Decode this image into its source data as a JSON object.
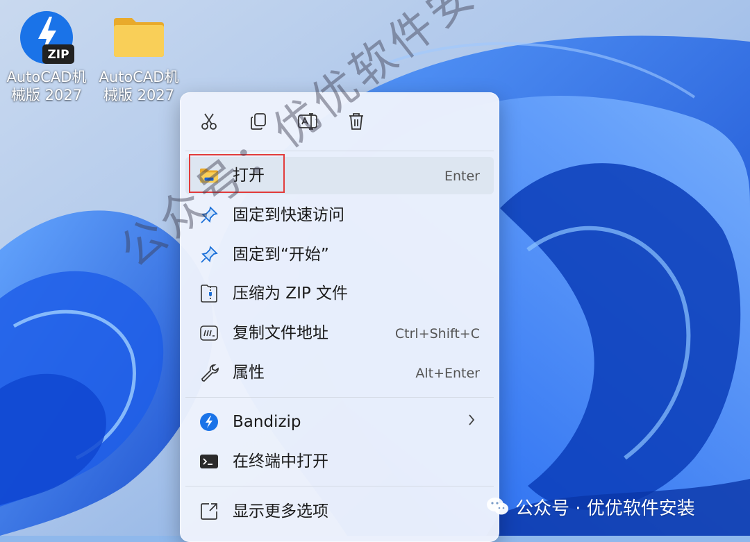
{
  "desktop": {
    "icons": [
      {
        "label": "AutoCAD机\n械版 2027",
        "icon": "bandizip-zip-icon",
        "badge": "ZIP"
      },
      {
        "label": "AutoCAD机\n械版 2027",
        "icon": "folder-icon"
      }
    ]
  },
  "context_menu": {
    "toolbar": [
      {
        "icon": "cut-icon"
      },
      {
        "icon": "copy-icon"
      },
      {
        "icon": "rename-icon"
      },
      {
        "icon": "delete-icon"
      }
    ],
    "items": [
      {
        "label": "打开",
        "shortcut": "Enter",
        "icon": "folder-open-icon"
      },
      {
        "label": "固定到快速访问",
        "shortcut": "",
        "icon": "pin-icon"
      },
      {
        "label": "固定到“开始”",
        "shortcut": "",
        "icon": "pin-icon"
      },
      {
        "label": "压缩为 ZIP 文件",
        "shortcut": "",
        "icon": "zip-file-icon"
      },
      {
        "label": "复制文件地址",
        "shortcut": "Ctrl+Shift+C",
        "icon": "copy-path-icon"
      },
      {
        "label": "属性",
        "shortcut": "Alt+Enter",
        "icon": "wrench-icon"
      },
      {
        "label": "Bandizip",
        "shortcut": "",
        "icon": "bandizip-icon",
        "submenu": true
      },
      {
        "label": "在终端中打开",
        "shortcut": "",
        "icon": "terminal-icon"
      },
      {
        "label": "显示更多选项",
        "shortcut": "",
        "icon": "more-options-icon"
      }
    ]
  },
  "watermark": {
    "diagonal": "公众号：优优软件安装",
    "corner": "公众号 · 优优软件安装"
  },
  "colors": {
    "accent": "#0067c0",
    "highlight_box": "#e23b3b",
    "folder": "#f6c445"
  }
}
